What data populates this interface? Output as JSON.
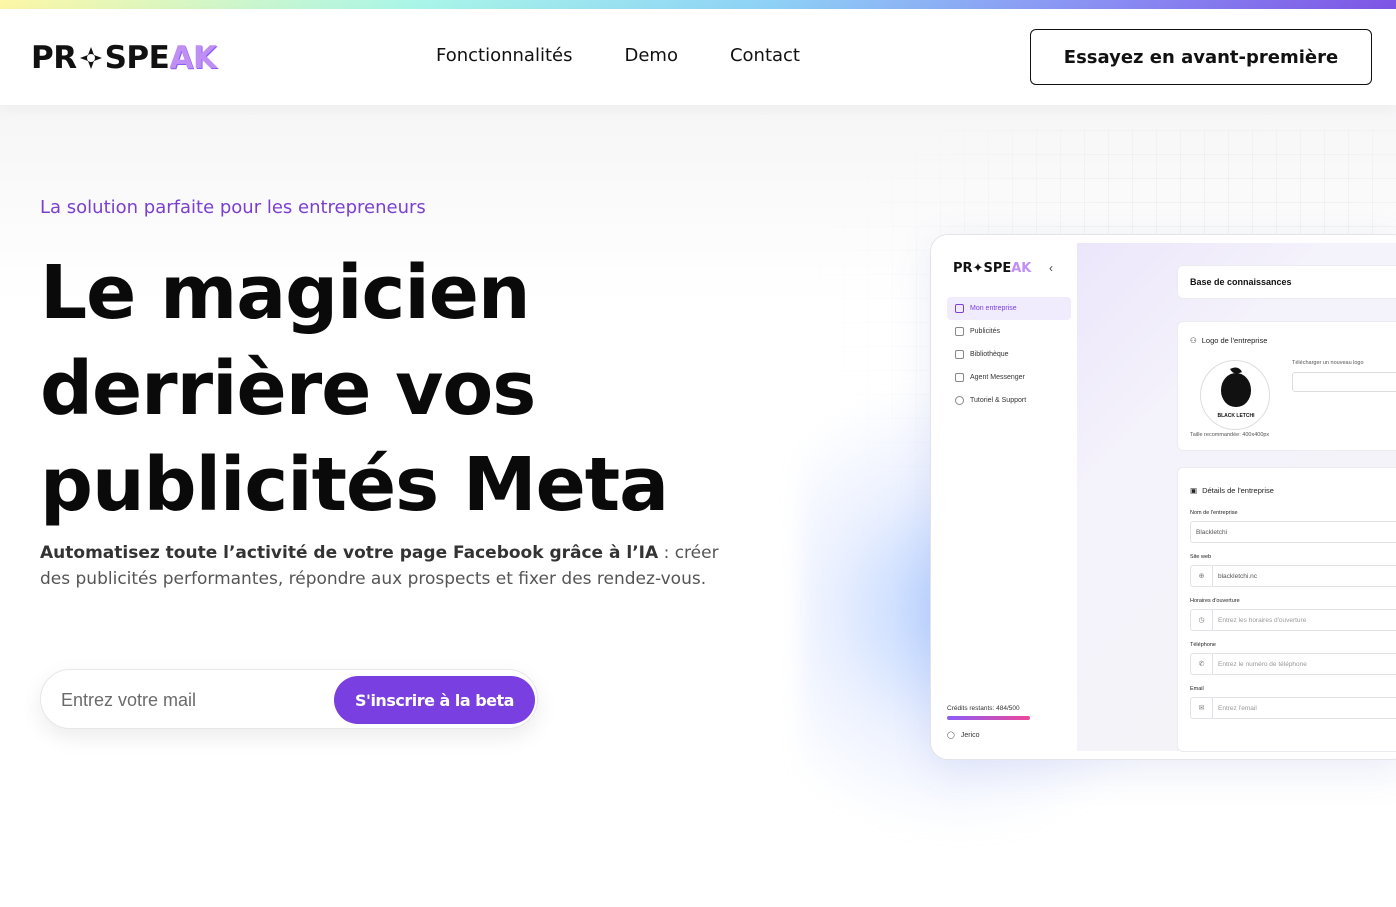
{
  "header": {
    "logo": {
      "part1": "PR",
      "part2": "SPE",
      "part3": "AK"
    },
    "nav": [
      "Fonctionnalités",
      "Demo",
      "Contact"
    ],
    "cta": "Essayez en avant-première"
  },
  "hero": {
    "eyebrow": "La solution parfaite pour les entrepreneurs",
    "title_lines": [
      "Le magicien",
      "derrière vos",
      "publicités Meta"
    ],
    "subtitle_bold": "Automatisez toute l’activité de votre page Facebook grâce à l’IA",
    "subtitle_rest": " : créer des publicités performantes, répondre aux prospects et fixer des rendez-vous.",
    "email_placeholder": "Entrez votre mail",
    "signup_button": "S'inscrire à la beta"
  },
  "mockup": {
    "logo": {
      "part1": "PR",
      "part2": "SPE",
      "part3": "AK"
    },
    "menu": [
      "Mon entreprise",
      "Publicités",
      "Bibliothèque",
      "Agent Messenger",
      "Tutoriel & Support"
    ],
    "active_index": 0,
    "credits": "Crédits restants: 484/500",
    "user": "Jerico",
    "kb_title": "Base de connaissances",
    "logo_section": "Logo de l'entreprise",
    "upload_label": "Télécharger un nouveau logo",
    "company_logo_text": "BLACK LETCHI",
    "recommended_size": "Taille recommandée: 400x400px",
    "details_section": "Détails de l'entreprise",
    "fields": [
      {
        "label": "Nom de l'entreprise",
        "value": "Blackletchi",
        "placeholder": ""
      },
      {
        "label": "Site web",
        "value": "blackletchi.nc",
        "placeholder": ""
      },
      {
        "label": "Horaires d'ouverture",
        "value": "",
        "placeholder": "Entrez les horaires d'ouverture"
      },
      {
        "label": "Téléphone",
        "value": "",
        "placeholder": "Entrez le numéro de téléphone"
      },
      {
        "label": "Email",
        "value": "",
        "placeholder": "Entrez l'email"
      }
    ]
  },
  "colors": {
    "accent": "#7a3fe0",
    "eyebrow": "#7a3fd0",
    "logo_highlight": "#c08ff5"
  }
}
